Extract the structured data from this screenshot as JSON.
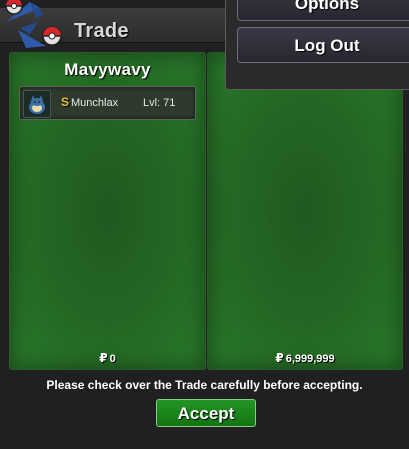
{
  "window": {
    "title": "Trade"
  },
  "left_panel": {
    "player_name": "Mavywavy",
    "items": [
      {
        "shiny_marker": "S",
        "pokemon_name": "Munchlax",
        "level": "Lvl: 71",
        "icon": "munchlax-sprite-icon"
      }
    ],
    "money_symbol": "₽",
    "money": "0"
  },
  "right_panel": {
    "money_symbol": "₽",
    "money": "6,999,999"
  },
  "footer": {
    "notice": "Please check over the Trade carefully before accepting.",
    "accept_label": "Accept"
  },
  "menu": {
    "options_label": "Options",
    "logout_label": "Log Out"
  },
  "colors": {
    "panel_green": "#246824",
    "accept_green": "#1b861b",
    "shiny_gold": "#e8c23a"
  }
}
